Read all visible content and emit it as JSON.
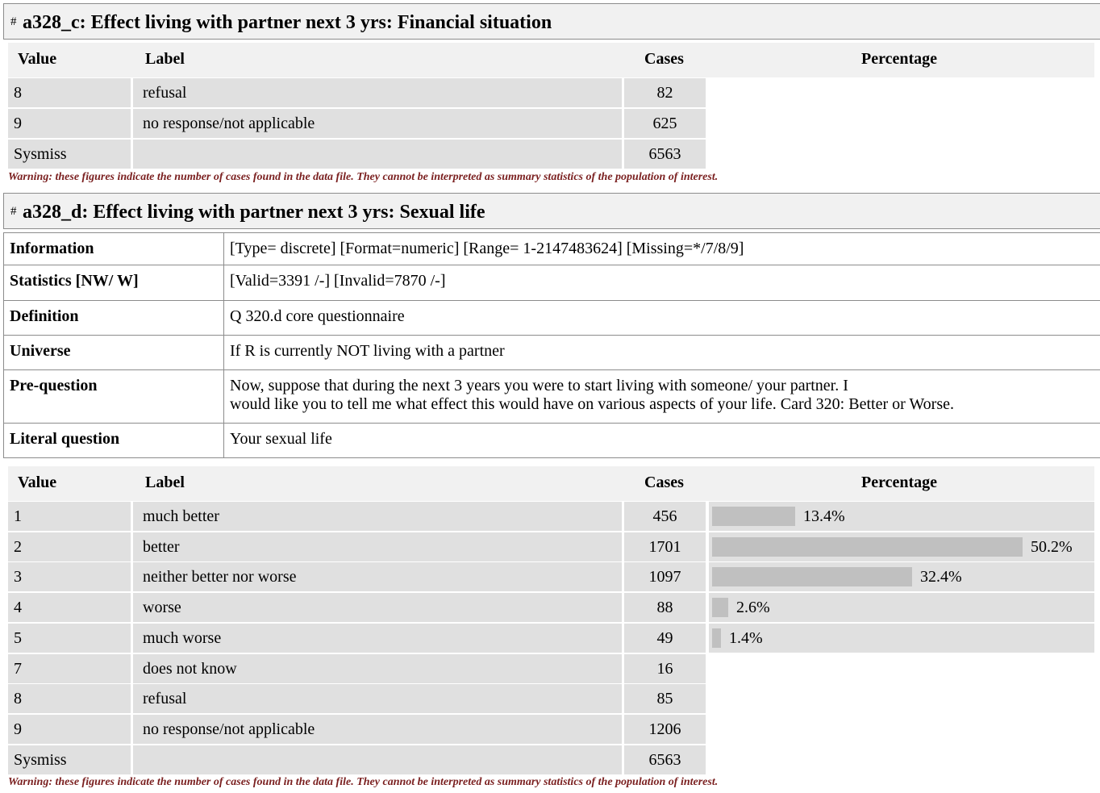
{
  "section1": {
    "hash": "#",
    "title": "a328_c: Effect living with partner next 3 yrs: Financial situation",
    "columns": {
      "value": "Value",
      "label": "Label",
      "cases": "Cases",
      "percentage": "Percentage"
    },
    "rows": [
      {
        "value": "8",
        "label": "refusal",
        "cases": "82"
      },
      {
        "value": "9",
        "label": "no response/not applicable",
        "cases": "625"
      },
      {
        "value": "Sysmiss",
        "label": "",
        "cases": "6563"
      }
    ],
    "warning": "Warning: these figures indicate the number of cases found in the data file. They cannot be interpreted as summary statistics of the population of interest."
  },
  "section2": {
    "hash": "#",
    "title": "a328_d: Effect living with partner next 3 yrs: Sexual life",
    "info": [
      {
        "key": "Information",
        "value": "[Type= discrete] [Format=numeric] [Range= 1-2147483624] [Missing=*/7/8/9]"
      },
      {
        "key": "Statistics [NW/ W]",
        "value": "[Valid=3391 /-] [Invalid=7870 /-]"
      },
      {
        "key": "Definition",
        "value": "Q 320.d core questionnaire"
      },
      {
        "key": "Universe",
        "value": "If R is currently NOT living with a partner"
      },
      {
        "key": "Pre-question",
        "value_line1": "Now, suppose that during the next 3 years you were to start living with someone/ your partner. I",
        "value_line2": "would like you to tell me what effect this would have on various aspects of your life. Card 320: Better or Worse."
      },
      {
        "key": "Literal question",
        "value": "Your sexual life"
      }
    ],
    "columns": {
      "value": "Value",
      "label": "Label",
      "cases": "Cases",
      "percentage": "Percentage"
    },
    "rows": [
      {
        "value": "1",
        "label": "much better",
        "cases": "456",
        "pct": "13.4%",
        "pct_value": 13.4
      },
      {
        "value": "2",
        "label": "better",
        "cases": "1701",
        "pct": "50.2%",
        "pct_value": 50.2
      },
      {
        "value": "3",
        "label": "neither better nor worse",
        "cases": "1097",
        "pct": "32.4%",
        "pct_value": 32.4
      },
      {
        "value": "4",
        "label": "worse",
        "cases": "88",
        "pct": "2.6%",
        "pct_value": 2.6
      },
      {
        "value": "5",
        "label": "much worse",
        "cases": "49",
        "pct": "1.4%",
        "pct_value": 1.4
      },
      {
        "value": "7",
        "label": "does not know",
        "cases": "16"
      },
      {
        "value": "8",
        "label": "refusal",
        "cases": "85"
      },
      {
        "value": "9",
        "label": "no response/not applicable",
        "cases": "1206"
      },
      {
        "value": "Sysmiss",
        "label": "",
        "cases": "6563"
      }
    ],
    "warning": "Warning: these figures indicate the number of cases found in the data file. They cannot be interpreted as summary statistics of the population of interest."
  }
}
